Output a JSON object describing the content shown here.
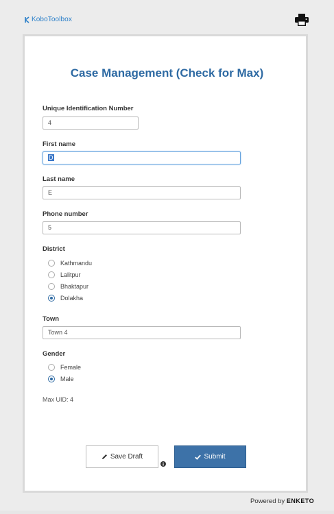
{
  "header": {
    "logo_text": "KoboToolbox",
    "print_icon": "printer-icon"
  },
  "form": {
    "title": "Case Management (Check for Max)",
    "fields": [
      {
        "label": "Unique Identification Number",
        "value": "4"
      },
      {
        "label": "First name",
        "value": "D"
      },
      {
        "label": "Last name",
        "value": "E"
      },
      {
        "label": "Phone number",
        "value": "5"
      }
    ],
    "district": {
      "label": "District",
      "options": [
        "Kathmandu",
        "Lalitpur",
        "Bhaktapur",
        "Dolakha"
      ],
      "selected": "Dolakha"
    },
    "town": {
      "label": "Town",
      "value": "Town 4"
    },
    "gender": {
      "label": "Gender",
      "options": [
        "Female",
        "Male"
      ],
      "selected": "Male"
    },
    "max_uid": "Max UID: 4"
  },
  "actions": {
    "save_draft_label": "Save Draft",
    "submit_label": "Submit"
  },
  "footer": {
    "powered_by": "Powered by",
    "brand": "ENKETO"
  },
  "colors": {
    "accent": "#2e6aa3",
    "submit_bg": "#3d72a8",
    "logo": "#2a7fc9"
  }
}
